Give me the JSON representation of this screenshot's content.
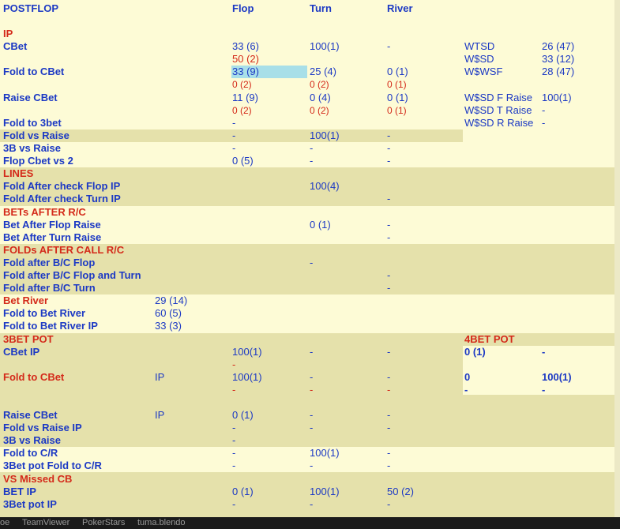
{
  "header": {
    "title": "POSTFLOP",
    "col_flop": "Flop",
    "col_turn": "Turn",
    "col_river": "River"
  },
  "ip": {
    "section": "IP",
    "cbet": {
      "label": "CBet",
      "flop": "33 (6)",
      "flop_red": "50 (2)",
      "turn": "100(1)",
      "river": "-"
    },
    "fold_cbet": {
      "label": "Fold to CBet",
      "flop": "33 (9)",
      "turn": "25 (4)",
      "river": "0 (1)",
      "flop_red": "0 (2)",
      "turn_red": "0 (2)",
      "river_red": "0 (1)"
    },
    "raise_cbet": {
      "label": "Raise CBet",
      "flop": "11 (9)",
      "turn": "0 (4)",
      "river": "0 (1)",
      "flop_red": "0 (2)",
      "turn_red": "0 (2)",
      "river_red": "0 (1)"
    },
    "fold_3bet": {
      "label": "Fold to 3bet",
      "flop": "-"
    },
    "fold_vs_raise": {
      "label": "Fold vs Raise",
      "flop": "-",
      "turn": "100(1)",
      "river": "-"
    },
    "threeb_vs_raise": {
      "label": "3B vs Raise",
      "flop": "-",
      "turn": "-",
      "river": "-"
    },
    "flop_cbet_vs2": {
      "label": "Flop Cbet vs 2",
      "flop": "0 (5)",
      "turn": "-",
      "river": "-"
    }
  },
  "stats": {
    "wtsd": {
      "label": "WTSD",
      "value": "26 (47)"
    },
    "wsd": {
      "label": "W$SD",
      "value": "33 (12)"
    },
    "wwsf": {
      "label": "W$WSF",
      "value": "28 (47)"
    },
    "wsd_f_raise": {
      "label": "W$SD F Raise",
      "value": "100(1)"
    },
    "wsd_t_raise": {
      "label": "W$SD T Raise",
      "value": "-"
    },
    "wsd_r_raise": {
      "label": "W$SD R Raise",
      "value": "-"
    }
  },
  "lines": {
    "section": "LINES",
    "fold_after_check_flop": {
      "label": "Fold After check Flop IP",
      "turn": "100(4)"
    },
    "fold_after_check_turn": {
      "label": "Fold After check Turn IP",
      "river": "-"
    }
  },
  "bets_after_rc": {
    "section": "BETs AFTER R/C",
    "flop_raise": {
      "label": "Bet After Flop Raise",
      "turn": "0 (1)",
      "river": "-"
    },
    "turn_raise": {
      "label": "Bet After Turn Raise",
      "river": "-"
    }
  },
  "folds_after_call": {
    "section": "FOLDs AFTER CALL R/C",
    "bc_flop": {
      "label": "Fold after B/C Flop",
      "turn": "-"
    },
    "bc_flop_turn": {
      "label": "Fold after B/C Flop and Turn",
      "river": "-"
    },
    "bc_turn": {
      "label": "Fold after B/C Turn",
      "river": "-"
    }
  },
  "river": {
    "bet_river": {
      "label": "Bet River",
      "value": "29 (14)"
    },
    "fold_bet_river": {
      "label": "Fold to Bet River",
      "value": "60 (5)"
    },
    "fold_bet_river_ip": {
      "label": "Fold to Bet River IP",
      "value": "33 (3)"
    }
  },
  "threebet_pot": {
    "section": "3BET POT",
    "cbet_ip": {
      "label": "CBet IP",
      "flop": "100(1)",
      "flop_red": "-",
      "turn": "-",
      "river": "-"
    },
    "fold_cbet": {
      "label": "Fold to CBet",
      "pos": "IP",
      "flop": "100(1)",
      "turn": "-",
      "river": "-",
      "flop_red": "-",
      "turn_red": "-",
      "river_red": "-"
    },
    "raise_cbet": {
      "label": "Raise CBet",
      "pos": "IP",
      "flop": "0 (1)",
      "turn": "-",
      "river": "-"
    },
    "fold_vs_raise_ip": {
      "label": "Fold vs Raise IP",
      "flop": "-",
      "turn": "-",
      "river": "-"
    },
    "threeb_vs_raise": {
      "label": "3B vs Raise",
      "flop": "-"
    },
    "fold_cr": {
      "label": "Fold to C/R",
      "flop": "-",
      "turn": "100(1)",
      "river": "-"
    },
    "pot_fold_cr": {
      "label": "3Bet pot Fold to C/R",
      "flop": "-",
      "turn": "-",
      "river": "-"
    }
  },
  "fourbet_pot": {
    "section": "4BET POT",
    "r1_a": "0 (1)",
    "r1_b": "-",
    "r2_a": "0",
    "r2_b": "100(1)",
    "r3_a": "-",
    "r3_b": "-"
  },
  "vs_missed_cb": {
    "section": "VS Missed CB",
    "bet_ip": {
      "label": "BET IP",
      "flop": "0 (1)",
      "turn": "100(1)",
      "river": "50 (2)"
    },
    "pot_ip": {
      "label": "3Bet pot IP",
      "flop": "-",
      "turn": "-",
      "river": "-"
    }
  },
  "taskbar": {
    "item1": "oe",
    "item2": "TeamViewer",
    "item3": "PokerStars",
    "item4": "tuma.blendo"
  }
}
